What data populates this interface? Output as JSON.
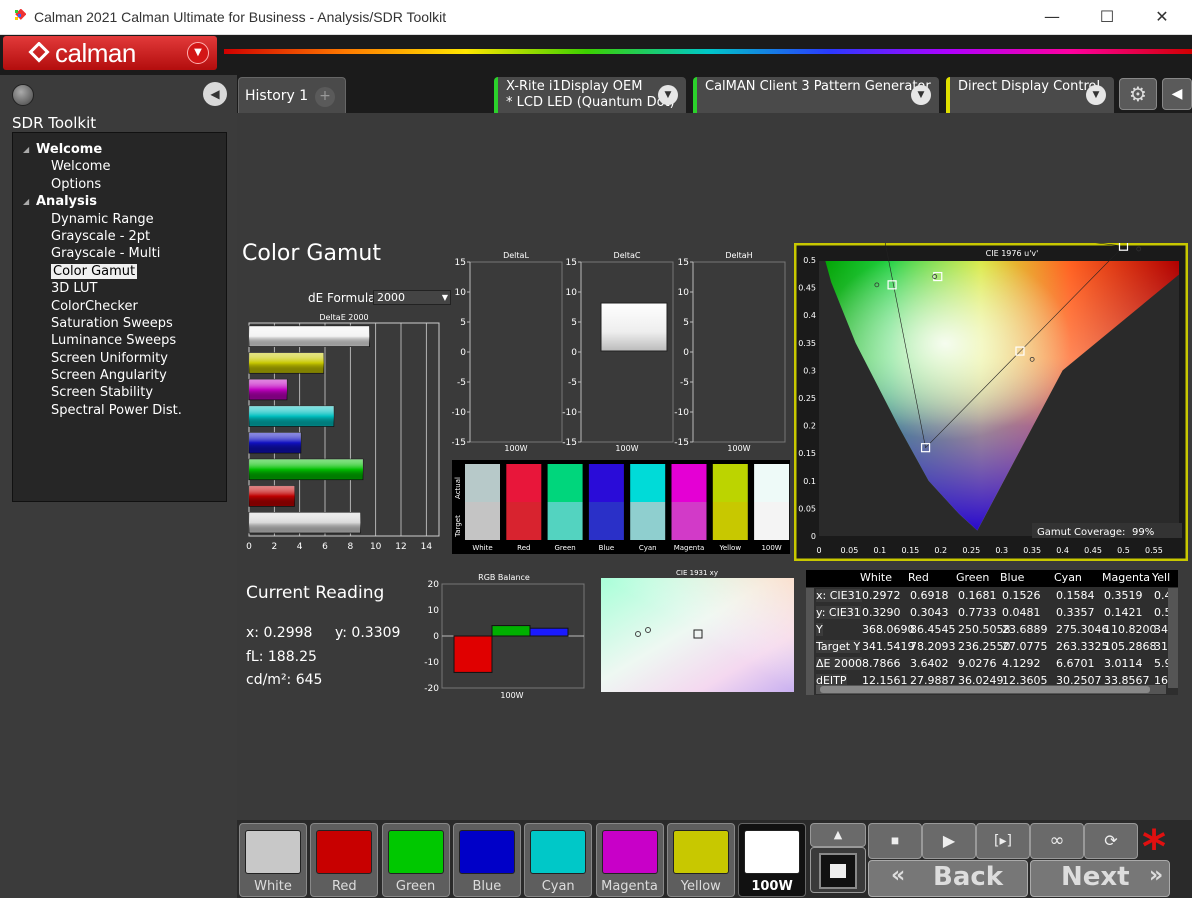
{
  "window": {
    "title": "Calman 2021 Calman Ultimate for Business  - Analysis/SDR Toolkit",
    "minimize": "—",
    "maximize": "☐",
    "close": "✕"
  },
  "logo": {
    "text": "calman"
  },
  "sidebar": {
    "heading": "SDR Toolkit",
    "groups": [
      {
        "label": "Welcome",
        "items": [
          "Welcome",
          "Options"
        ]
      },
      {
        "label": "Analysis",
        "items": [
          "Dynamic Range",
          "Grayscale - 2pt",
          "Grayscale - Multi",
          "Color Gamut",
          "3D LUT",
          "ColorChecker",
          "Saturation Sweeps",
          "Luminance Sweeps",
          "Screen Uniformity",
          "Screen Angularity",
          "Screen Stability",
          "Spectral Power Dist."
        ]
      }
    ],
    "selected": "Color Gamut"
  },
  "tabs": {
    "history": "History 1",
    "plus": "+",
    "devices": [
      {
        "line1": "X-Rite i1Display OEM",
        "line2": "* LCD LED (Quantum Dot)",
        "color": "#2bd12b"
      },
      {
        "line1": "CalMAN Client 3 Pattern Generator",
        "line2": "",
        "color": "#2bd12b"
      },
      {
        "line1": "Direct Display Control",
        "line2": "",
        "color": "#e0e000"
      }
    ]
  },
  "page": {
    "title": "Color Gamut",
    "de_formula_label": "dE Formula:",
    "de_formula_value": "2000"
  },
  "deltaE_chart": {
    "title": "DeltaE 2000",
    "xticks": [
      "0",
      "2",
      "4",
      "6",
      "8",
      "10",
      "12",
      "14"
    ],
    "bars": [
      {
        "name": "White",
        "value": 9.5,
        "color": "#f2f2f2"
      },
      {
        "name": "Yellow",
        "value": 5.9,
        "color": "#c8c800"
      },
      {
        "name": "Magenta",
        "value": 3.0,
        "color": "#c000c0"
      },
      {
        "name": "Cyan",
        "value": 6.7,
        "color": "#00c0c0"
      },
      {
        "name": "Blue",
        "value": 4.1,
        "color": "#1010c0"
      },
      {
        "name": "Green",
        "value": 9.0,
        "color": "#00c000"
      },
      {
        "name": "Red",
        "value": 3.6,
        "color": "#c00000"
      },
      {
        "name": "White",
        "value": 8.8,
        "color": "#d8d8d8"
      }
    ]
  },
  "delta_charts": [
    {
      "title": "DeltaL",
      "ticks": [
        "15",
        "10",
        "5",
        "0",
        "-5",
        "-10",
        "-15"
      ],
      "xlabel": "100W"
    },
    {
      "title": "DeltaC",
      "ticks": [
        "15",
        "10",
        "5",
        "0",
        "-5",
        "-10",
        "-15"
      ],
      "xlabel": "100W"
    },
    {
      "title": "DeltaH",
      "ticks": [
        "15",
        "10",
        "5",
        "0",
        "-5",
        "-10",
        "-15"
      ],
      "xlabel": "100W"
    }
  ],
  "swatch_compare": {
    "actual_label": "Actual",
    "target_label": "Target",
    "items": [
      {
        "name": "White",
        "actual": "#b7c9c9",
        "target": "#c4c4c4"
      },
      {
        "name": "Red",
        "actual": "#e8163a",
        "target": "#d8232f"
      },
      {
        "name": "Green",
        "actual": "#00d67c",
        "target": "#53d3c0"
      },
      {
        "name": "Blue",
        "actual": "#2a0cd8",
        "target": "#2a30c8"
      },
      {
        "name": "Cyan",
        "actual": "#00dbd8",
        "target": "#8fcfcf"
      },
      {
        "name": "Magenta",
        "actual": "#e400d4",
        "target": "#d23ac8"
      },
      {
        "name": "Yellow",
        "actual": "#bcd400",
        "target": "#c8c800"
      },
      {
        "name": "100W",
        "actual": "#eefaf8",
        "target": "#f4f4f4"
      }
    ]
  },
  "cie_uv": {
    "title": "CIE 1976 u'v'",
    "xticks": [
      "0",
      "0.05",
      "0.1",
      "0.15",
      "0.2",
      "0.25",
      "0.3",
      "0.35",
      "0.4",
      "0.45",
      "0.5",
      "0.55"
    ],
    "yticks": [
      "0.55",
      "0.5",
      "0.45",
      "0.4",
      "0.35",
      "0.3",
      "0.25",
      "0.2",
      "0.15",
      "0.1",
      "0.05",
      "0"
    ],
    "coverage_label": "Gamut Coverage:",
    "coverage_value": "99%"
  },
  "current_reading": {
    "title": "Current Reading",
    "x": "x: 0.2998",
    "y": "y: 0.3309",
    "fl": "fL: 188.25",
    "cdm": "cd/m²: 645"
  },
  "rgb_balance": {
    "title": "RGB Balance",
    "ticks": [
      "20",
      "10",
      "0",
      "-10",
      "-20"
    ],
    "xlabel": "100W",
    "chart_data": {
      "type": "bar",
      "categories": [
        "Red",
        "Green",
        "Blue"
      ],
      "values": [
        -14,
        4,
        3
      ],
      "ylim": [
        -20,
        20
      ]
    }
  },
  "cie_xy": {
    "title": "CIE 1931 xy"
  },
  "table": {
    "columns": [
      "",
      "White",
      "Red",
      "Green",
      "Blue",
      "Cyan",
      "Magenta",
      "Yell"
    ],
    "rows": [
      [
        "x: CIE31",
        "0.2972",
        "0.6918",
        "0.1681",
        "0.1526",
        "0.1584",
        "0.3519",
        "0.4"
      ],
      [
        "y: CIE31",
        "0.3290",
        "0.3043",
        "0.7733",
        "0.0481",
        "0.3357",
        "0.1421",
        "0.5"
      ],
      [
        "Y",
        "368.0690",
        "86.4545",
        "250.5058",
        "23.6889",
        "275.3046",
        "110.8200",
        "34"
      ],
      [
        "Target Y",
        "341.5419",
        "78.2093",
        "236.2550",
        "27.0775",
        "263.3325",
        "105.2868",
        "31"
      ],
      [
        "ΔE 2000",
        "8.7866",
        "3.6402",
        "9.0276",
        "4.1292",
        "6.6701",
        "3.0114",
        "5.9"
      ],
      [
        "dEITP",
        "12.1561",
        "27.9887",
        "36.0249",
        "12.3605",
        "30.2507",
        "33.8567",
        "16"
      ]
    ]
  },
  "swatches": [
    {
      "label": "White",
      "color": "#c8c8c8"
    },
    {
      "label": "Red",
      "color": "#c80000"
    },
    {
      "label": "Green",
      "color": "#00c800"
    },
    {
      "label": "Blue",
      "color": "#0000c8"
    },
    {
      "label": "Cyan",
      "color": "#00c8c8"
    },
    {
      "label": "Magenta",
      "color": "#c800c8"
    },
    {
      "label": "Yellow",
      "color": "#c8c800"
    },
    {
      "label": "100W",
      "color": "#ffffff"
    }
  ],
  "nav": {
    "back": "Back",
    "next": "Next",
    "back_arrow": "«",
    "next_arrow": "»"
  }
}
